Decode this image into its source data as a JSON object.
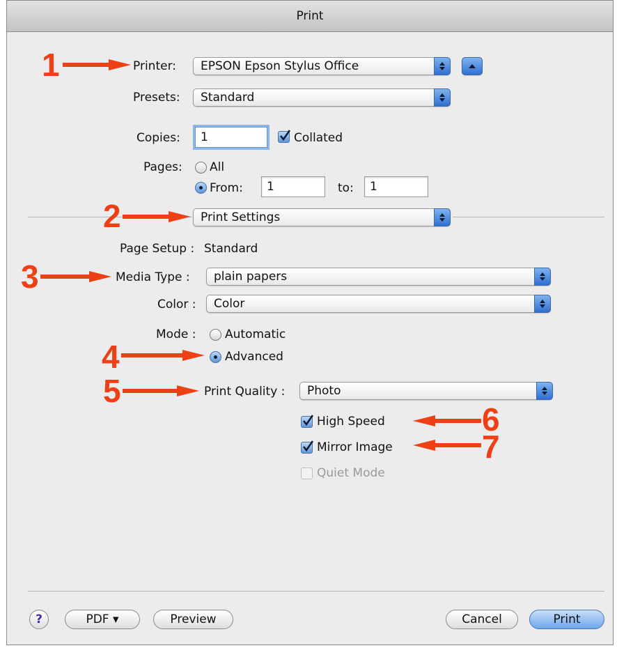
{
  "window": {
    "title": "Print"
  },
  "printer": {
    "label": "Printer:",
    "value": "EPSON Epson Stylus Office"
  },
  "presets": {
    "label": "Presets:",
    "value": "Standard"
  },
  "copies": {
    "label": "Copies:",
    "value": "1",
    "collated_label": "Collated",
    "collated_checked": true
  },
  "pages": {
    "label": "Pages:",
    "all_label": "All",
    "from_label": "From:",
    "from_value": "1",
    "to_label": "to:",
    "to_value": "1",
    "selected": "From"
  },
  "section_popup": {
    "value": "Print Settings"
  },
  "page_setup": {
    "label": "Page Setup :",
    "value": "Standard"
  },
  "media_type": {
    "label": "Media Type :",
    "value": "plain papers"
  },
  "color": {
    "label": "Color :",
    "value": "Color"
  },
  "mode": {
    "label": "Mode :",
    "automatic_label": "Automatic",
    "advanced_label": "Advanced",
    "selected": "Advanced"
  },
  "print_quality": {
    "label": "Print Quality :",
    "value": "Photo"
  },
  "options": {
    "high_speed_label": "High Speed",
    "high_speed_checked": true,
    "mirror_image_label": "Mirror Image",
    "mirror_image_checked": true,
    "quiet_mode_label": "Quiet Mode",
    "quiet_mode_checked": false,
    "quiet_mode_enabled": false
  },
  "footer": {
    "help_label": "?",
    "pdf_label": "PDF ▾",
    "preview_label": "Preview",
    "cancel_label": "Cancel",
    "print_label": "Print"
  },
  "callouts": [
    "1",
    "2",
    "3",
    "4",
    "5",
    "6",
    "7"
  ],
  "colors": {
    "callout": "#ee4015",
    "accent": "#5f97dd"
  }
}
